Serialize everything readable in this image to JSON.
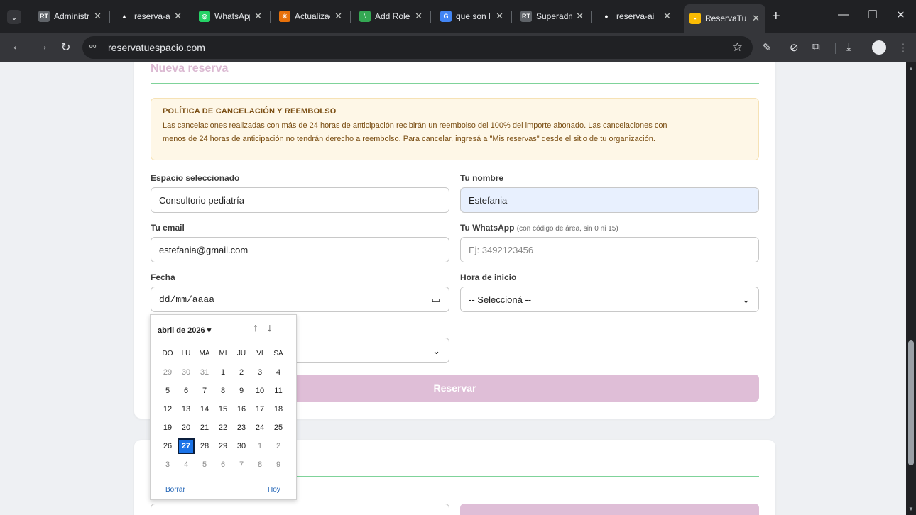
{
  "browser": {
    "tabs": [
      {
        "title": "Administr",
        "favicon_color": "#5f6368",
        "favicon_text": "RT"
      },
      {
        "title": "reserva-ai",
        "favicon_color": "#202124",
        "favicon_text": "▲"
      },
      {
        "title": "WhatsApp",
        "favicon_color": "#25d366",
        "favicon_text": "◎"
      },
      {
        "title": "Actualizac",
        "favicon_color": "#e8710a",
        "favicon_text": "✳"
      },
      {
        "title": "Add Role",
        "favicon_color": "#34a853",
        "favicon_text": "ϟ"
      },
      {
        "title": "que son lo",
        "favicon_color": "#4285f4",
        "favicon_text": "G"
      },
      {
        "title": "Superadm",
        "favicon_color": "#5f6368",
        "favicon_text": "RT"
      },
      {
        "title": "reserva-ai",
        "favicon_color": "#202124",
        "favicon_text": "●"
      },
      {
        "title": "ReservaTu",
        "favicon_color": "#fbbc04",
        "favicon_text": "▪"
      }
    ],
    "url": "reservatuespacio.com"
  },
  "form": {
    "title": "Nueva reserva",
    "policy_title": "POLÍTICA DE CANCELACIÓN Y REEMBOLSO",
    "policy_line1": "Las cancelaciones realizadas con más de 24 horas de anticipación recibirán un reembolso del 100% del importe abonado. Las cancelaciones con",
    "policy_line2": "menos de 24 horas de anticipación no tendrán derecho a reembolso. Para cancelar, ingresá a \"Mis reservas\" desde el sitio de tu organización.",
    "espacio_label": "Espacio seleccionado",
    "espacio_value": "Consultorio pediatría",
    "nombre_label": "Tu nombre",
    "nombre_value": "Estefania",
    "email_label": "Tu email",
    "email_value": "estefania@gmail.com",
    "whatsapp_label": "Tu WhatsApp",
    "whatsapp_hint": "(con código de área, sin 0 ni 15)",
    "whatsapp_placeholder": "Ej: 3492123456",
    "fecha_label": "Fecha",
    "fecha_value": "dd/mm/aaaa",
    "hora_label": "Hora de inicio",
    "hora_value": "-- Seleccioná --",
    "submit_label": "Reservar"
  },
  "datepicker": {
    "month_label": "abril de 2026 ▾",
    "weekdays": [
      "DO",
      "LU",
      "MA",
      "MI",
      "JU",
      "VI",
      "SA"
    ],
    "weeks": [
      [
        {
          "d": "29",
          "m": true
        },
        {
          "d": "30",
          "m": true
        },
        {
          "d": "31",
          "m": true
        },
        {
          "d": "1"
        },
        {
          "d": "2"
        },
        {
          "d": "3"
        },
        {
          "d": "4"
        }
      ],
      [
        {
          "d": "5"
        },
        {
          "d": "6"
        },
        {
          "d": "7"
        },
        {
          "d": "8"
        },
        {
          "d": "9"
        },
        {
          "d": "10"
        },
        {
          "d": "11"
        }
      ],
      [
        {
          "d": "12"
        },
        {
          "d": "13"
        },
        {
          "d": "14"
        },
        {
          "d": "15"
        },
        {
          "d": "16"
        },
        {
          "d": "17"
        },
        {
          "d": "18"
        }
      ],
      [
        {
          "d": "19"
        },
        {
          "d": "20"
        },
        {
          "d": "21"
        },
        {
          "d": "22"
        },
        {
          "d": "23"
        },
        {
          "d": "24"
        },
        {
          "d": "25"
        }
      ],
      [
        {
          "d": "26"
        },
        {
          "d": "27",
          "today": true
        },
        {
          "d": "28"
        },
        {
          "d": "29"
        },
        {
          "d": "30"
        },
        {
          "d": "1",
          "m": true
        },
        {
          "d": "2",
          "m": true
        }
      ],
      [
        {
          "d": "3",
          "m": true
        },
        {
          "d": "4",
          "m": true
        },
        {
          "d": "5",
          "m": true
        },
        {
          "d": "6",
          "m": true
        },
        {
          "d": "7",
          "m": true
        },
        {
          "d": "8",
          "m": true
        },
        {
          "d": "9",
          "m": true
        }
      ]
    ],
    "clear_label": "Borrar",
    "today_label": "Hoy"
  }
}
